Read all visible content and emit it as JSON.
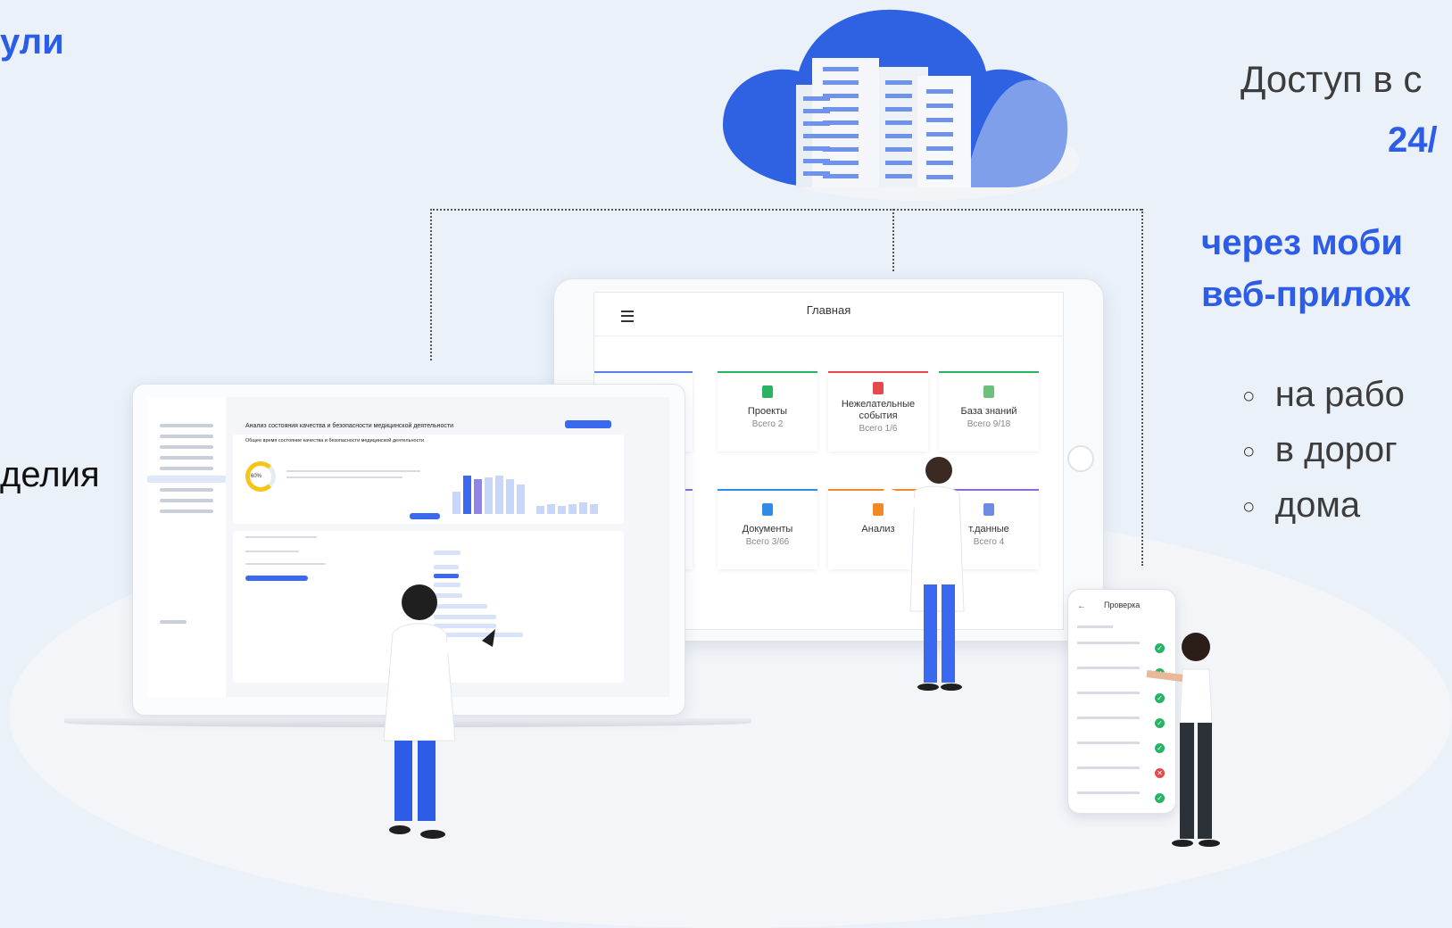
{
  "slide": {
    "left_heading_fragment": "ули",
    "left_text_fragment": "делия",
    "right_access_prefix": "Доступ в с",
    "right_access_highlight": "24/",
    "right_mobile_line1": "через моби",
    "right_mobile_line2": "веб-прилож",
    "bullets": [
      "на рабо",
      "в дорог",
      "дома"
    ],
    "bullet_marker": "○"
  },
  "tablet": {
    "title": "Главная",
    "cards": [
      {
        "title": "Проекты",
        "subtitle": "Всего 2",
        "accent": "#28b463",
        "icon_color": "#28b463",
        "icon": "document-icon"
      },
      {
        "title": "Нежелательные события",
        "subtitle": "Всего 1/6",
        "accent": "#e5484d",
        "icon_color": "#e5484d",
        "icon": "alert-icon"
      },
      {
        "title": "База знаний",
        "subtitle": "Всего 9/18",
        "accent": "#28b463",
        "icon_color": "#6cc07a",
        "icon": "book-icon"
      },
      {
        "title": "Документы",
        "subtitle": "Всего 3/66",
        "accent": "#2d8de6",
        "icon_color": "#2d8de6",
        "icon": "file-icon"
      },
      {
        "title": "Анализ",
        "subtitle": "",
        "accent": "#f08a24",
        "icon_color": "#f08a24",
        "icon": "chart-icon"
      },
      {
        "title": "т.данные",
        "subtitle": "Всего 4",
        "accent": "#8e6ad8",
        "icon_color": "#6d8be6",
        "icon": "data-icon"
      }
    ]
  },
  "laptop": {
    "title": "Анализ состояния качества и безопасности медицинской деятельности",
    "subtitle": "Общее время состояние качества и безопасности медицинской деятельности",
    "gauge_label": "60%"
  },
  "phone": {
    "title": "Проверка",
    "checks": [
      "ok",
      "ok",
      "ok",
      "ok",
      "ok",
      "fail",
      "ok"
    ]
  },
  "colors": {
    "accent": "#2d5ce6",
    "success": "#28b463",
    "danger": "#e5484d"
  }
}
